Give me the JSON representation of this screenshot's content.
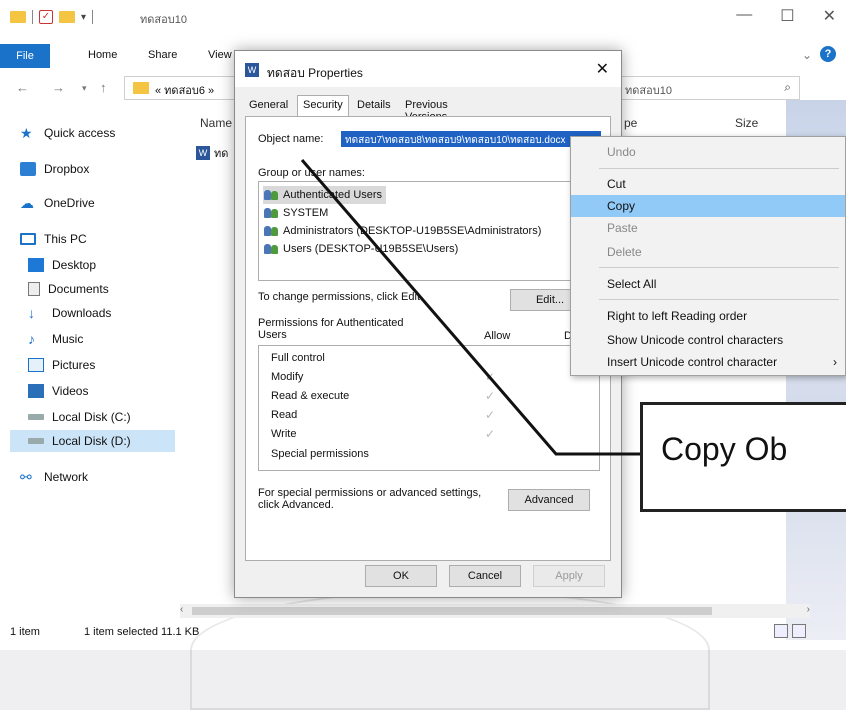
{
  "explorer": {
    "title": "ทดสอบ10",
    "ribbon_tabs": [
      "File",
      "Home",
      "Share",
      "View"
    ],
    "address_text": "« ทดสอบ6 »",
    "search_placeholder": "ทดสอบ10",
    "nav_items": [
      "Quick access",
      "Dropbox",
      "OneDrive",
      "This PC",
      "Desktop",
      "Documents",
      "Downloads",
      "Music",
      "Pictures",
      "Videos",
      "Local Disk (C:)",
      "Local Disk (D:)",
      "Network"
    ],
    "columns": {
      "name": "Name",
      "type": "pe",
      "size": "Size"
    },
    "file_name": "ทด",
    "status": {
      "count": "1 item",
      "selected": "1 item selected  11.1 KB"
    }
  },
  "dialog": {
    "title": "ทดสอบ Properties",
    "tabs": [
      "General",
      "Security",
      "Details",
      "Previous Versions"
    ],
    "object_name_label": "Object name:",
    "object_name_value": "ทดสอบ7\\ทดสอบ8\\ทดสอบ9\\ทดสอบ10\\ทดสอบ.docx",
    "group_label": "Group or user names:",
    "users": [
      "Authenticated Users",
      "SYSTEM",
      "Administrators (DESKTOP-U19B5SE\\Administrators)",
      "Users (DESKTOP-U19B5SE\\Users)"
    ],
    "change_perm_label": "To change permissions, click Edit.",
    "edit_button": "Edit...",
    "perm_for_label": "Permissions for Authenticated Users",
    "allow_header": "Allow",
    "deny_header": "Deny",
    "permissions": [
      "Full control",
      "Modify",
      "Read & execute",
      "Read",
      "Write",
      "Special permissions"
    ],
    "special_text": "For special permissions or advanced settings, click Advanced.",
    "advanced_button": "Advanced",
    "ok_button": "OK",
    "cancel_button": "Cancel",
    "apply_button": "Apply"
  },
  "context_menu": {
    "items": [
      "Undo",
      "Cut",
      "Copy",
      "Paste",
      "Delete",
      "Select All",
      "Right to left Reading order",
      "Show Unicode control characters",
      "Insert Unicode control character"
    ]
  },
  "annotation": {
    "text": "Copy Ob"
  },
  "colors": {
    "accent": "#1a73c8",
    "selection": "#1f62c4",
    "menu_highlight": "#91c9f7"
  }
}
